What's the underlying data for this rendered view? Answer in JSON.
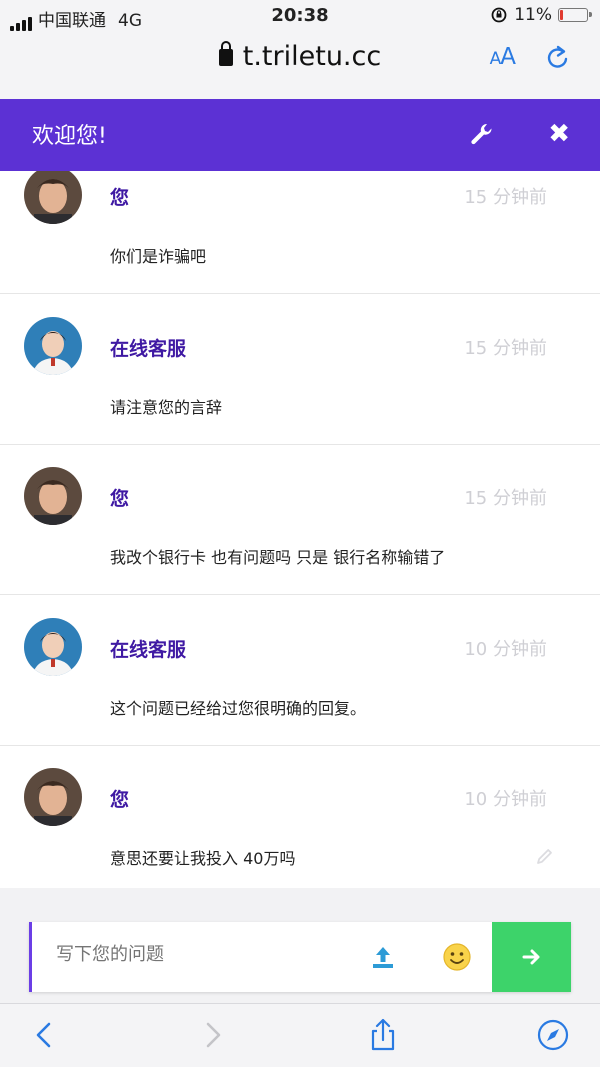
{
  "status_bar": {
    "carrier": "中国联通",
    "network": "4G",
    "time": "20:38",
    "battery": "11%",
    "battery_level": 0.11
  },
  "address_bar": {
    "url": "t.triletu.cc",
    "text_size_label_small": "A",
    "text_size_label_large": "A"
  },
  "chat_header": {
    "title": "欢迎您!"
  },
  "messages": [
    {
      "sender": "您",
      "time": "15 分钟前",
      "text": "你们是诈骗吧",
      "avatar": "user"
    },
    {
      "sender": "在线客服",
      "time": "15 分钟前",
      "text": "请注意您的言辞",
      "avatar": "agent"
    },
    {
      "sender": "您",
      "time": "15 分钟前",
      "text": "我改个银行卡 也有问题吗 只是 银行名称输错了",
      "avatar": "user"
    },
    {
      "sender": "在线客服",
      "time": "10 分钟前",
      "text": "这个问题已经给过您很明确的回复。",
      "avatar": "agent"
    },
    {
      "sender": "您",
      "time": "10 分钟前",
      "text": "意思还要让我投入 40万吗",
      "avatar": "user"
    }
  ],
  "composer": {
    "placeholder": "写下您的问题"
  },
  "colors": {
    "header": "#5c31d4",
    "sender": "#3f19a3",
    "send_button": "#3dd36a",
    "ios_blue": "#2a7ae2"
  }
}
